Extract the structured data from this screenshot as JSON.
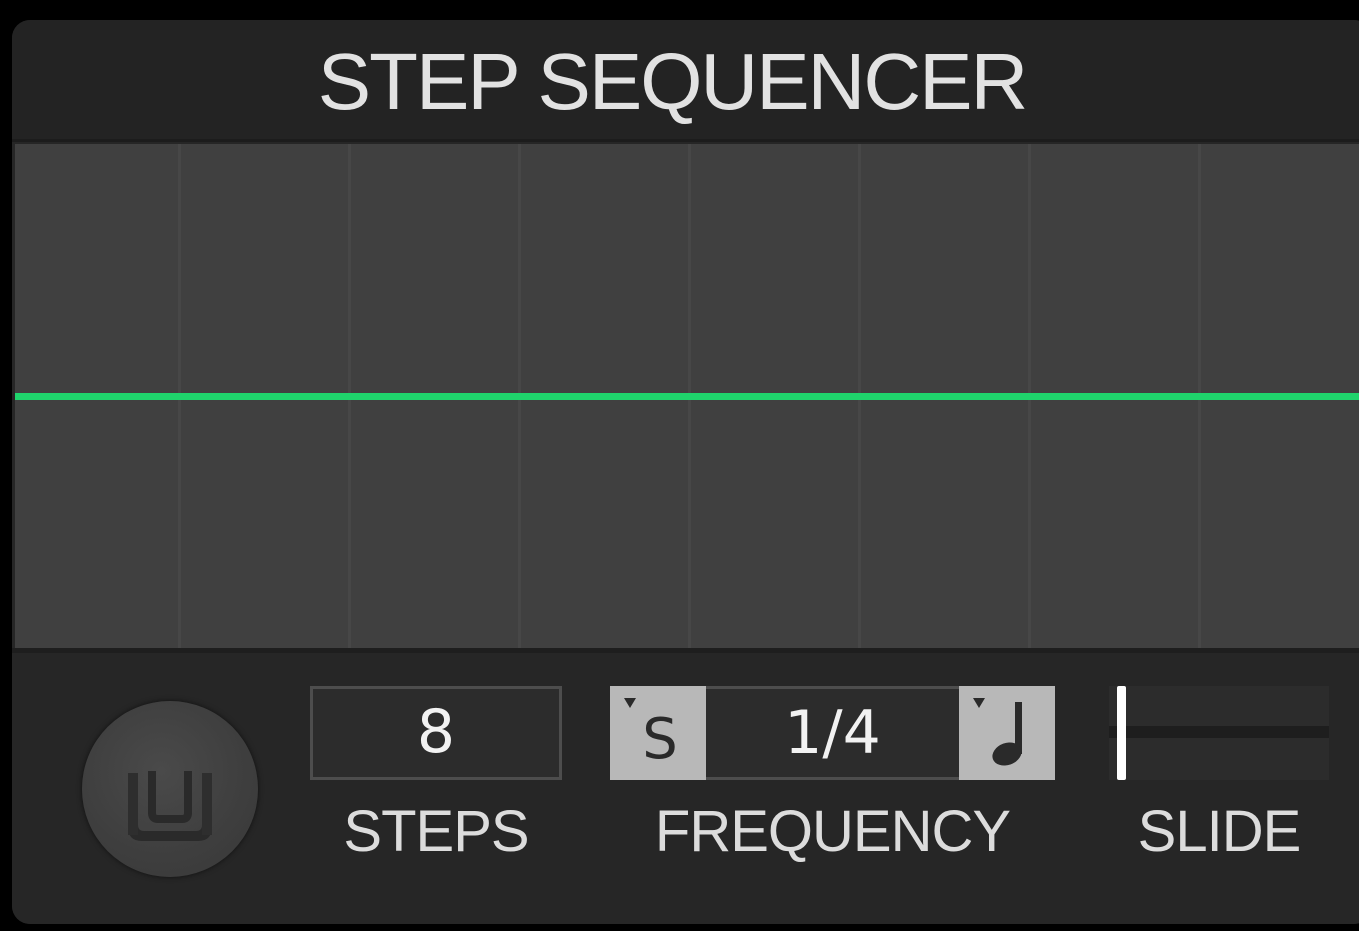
{
  "title": "STEP SEQUENCER",
  "sequencer": {
    "steps": 8,
    "level": 0.5,
    "line_color": "#1fd46c"
  },
  "controls": {
    "power_icon": "power-u-icon",
    "steps": {
      "value": "8",
      "label": "STEPS"
    },
    "frequency": {
      "left_button_glyph": "S",
      "left_button_icon": "sync-s-icon",
      "value": "1/4",
      "right_button_icon": "quarter-note-icon",
      "label": "FREQUENCY"
    },
    "slide": {
      "value": 0,
      "label": "SLIDE"
    }
  }
}
